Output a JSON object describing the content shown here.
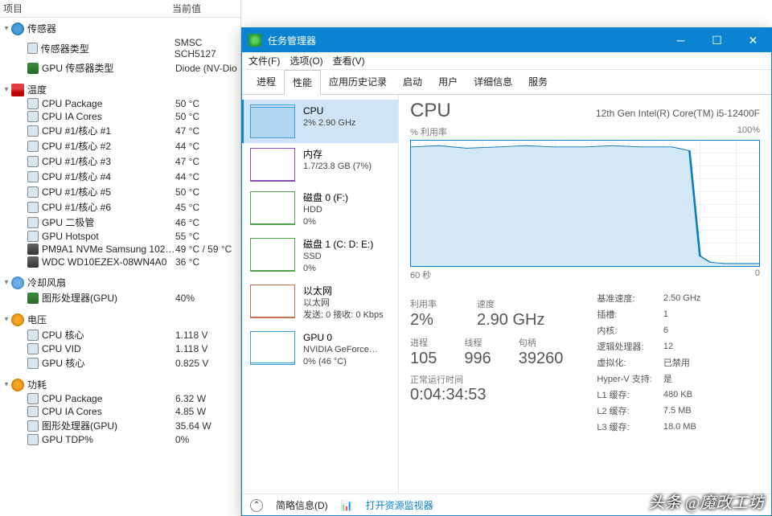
{
  "left": {
    "hdr_item": "项目",
    "hdr_val": "当前值",
    "sensors_label": "传感器",
    "sensor_type": {
      "label": "传感器类型",
      "val": "SMSC SCH5127"
    },
    "gpu_sensor_type": {
      "label": "GPU 传感器类型",
      "val": "Diode  (NV-Dio"
    },
    "temp_label": "温度",
    "temps": [
      {
        "label": "CPU Package",
        "val": "50 °C"
      },
      {
        "label": "CPU IA Cores",
        "val": "50 °C"
      },
      {
        "label": "CPU #1/核心 #1",
        "val": "47 °C"
      },
      {
        "label": "CPU #1/核心 #2",
        "val": "44 °C"
      },
      {
        "label": "CPU #1/核心 #3",
        "val": "47 °C"
      },
      {
        "label": "CPU #1/核心 #4",
        "val": "44 °C"
      },
      {
        "label": "CPU #1/核心 #5",
        "val": "50 °C"
      },
      {
        "label": "CPU #1/核心 #6",
        "val": "45 °C"
      },
      {
        "label": "GPU 二极管",
        "val": "46 °C"
      },
      {
        "label": "GPU Hotspot",
        "val": "55 °C"
      }
    ],
    "disks": [
      {
        "label": "PM9A1 NVMe Samsung 102…",
        "val": "49 °C / 59 °C"
      },
      {
        "label": "WDC WD10EZEX-08WN4A0",
        "val": "36 °C"
      }
    ],
    "fan_label": "冷却风扇",
    "fans": [
      {
        "label": "图形处理器(GPU)",
        "val": "40%"
      }
    ],
    "volt_label": "电压",
    "volts": [
      {
        "label": "CPU 核心",
        "val": "1.118 V"
      },
      {
        "label": "CPU VID",
        "val": "1.118 V"
      },
      {
        "label": "GPU 核心",
        "val": "0.825 V"
      }
    ],
    "power_label": "功耗",
    "powers": [
      {
        "label": "CPU Package",
        "val": "6.32 W"
      },
      {
        "label": "CPU IA Cores",
        "val": "4.85 W"
      },
      {
        "label": "图形处理器(GPU)",
        "val": "35.64 W"
      },
      {
        "label": "GPU TDP%",
        "val": "0%"
      }
    ]
  },
  "tm": {
    "title": "任务管理器",
    "menus": [
      "文件(F)",
      "选项(O)",
      "查看(V)"
    ],
    "tabs": [
      "进程",
      "性能",
      "应用历史记录",
      "启动",
      "用户",
      "详细信息",
      "服务"
    ],
    "side": [
      {
        "t": "CPU",
        "s": "2% 2.90 GHz",
        "color": "#3e9cd6"
      },
      {
        "t": "内存",
        "s": "1.7/23.8 GB (7%)",
        "color": "#8b4fb3"
      },
      {
        "t": "磁盘 0 (F:)",
        "s": "HDD\n0%",
        "color": "#4fa34f"
      },
      {
        "t": "磁盘 1 (C: D: E:)",
        "s": "SSD\n0%",
        "color": "#4fa34f"
      },
      {
        "t": "以太网",
        "s": "以太网\n发送: 0 接收: 0 Kbps",
        "color": "#c0724a"
      },
      {
        "t": "GPU 0",
        "s": "NVIDIA GeForce…\n0% (46 °C)",
        "color": "#3e9cd6"
      }
    ],
    "main": {
      "big": "CPU",
      "model": "12th Gen Intel(R) Core(TM) i5-12400F",
      "util_lbl": "% 利用率",
      "util_max": "100%",
      "x_left": "60 秒",
      "x_right": "0",
      "stats1": [
        {
          "lbl": "利用率",
          "val": "2%"
        },
        {
          "lbl": "速度",
          "val": "2.90 GHz"
        }
      ],
      "stats2": [
        {
          "lbl": "进程",
          "val": "105"
        },
        {
          "lbl": "线程",
          "val": "996"
        },
        {
          "lbl": "句柄",
          "val": "39260"
        }
      ],
      "uptime_lbl": "正常运行时间",
      "uptime": "0:04:34:53",
      "details": [
        [
          "基准速度:",
          "2.50 GHz"
        ],
        [
          "插槽:",
          "1"
        ],
        [
          "内核:",
          "6"
        ],
        [
          "逻辑处理器:",
          "12"
        ],
        [
          "虚拟化:",
          "已禁用"
        ],
        [
          "Hyper-V 支持:",
          "是"
        ],
        [
          "L1 缓存:",
          "480 KB"
        ],
        [
          "L2 缓存:",
          "7.5 MB"
        ],
        [
          "L3 缓存:",
          "18.0 MB"
        ]
      ]
    },
    "footer": {
      "brief": "简略信息(D)",
      "link": "打开资源监视器"
    }
  },
  "chart_data": {
    "type": "line",
    "title": "% 利用率",
    "xlabel": "60 秒 → 0",
    "ylabel": "%",
    "ylim": [
      0,
      100
    ],
    "x": [
      0,
      5,
      10,
      15,
      20,
      25,
      30,
      35,
      40,
      45,
      48,
      50,
      52,
      54,
      56,
      58,
      60
    ],
    "values": [
      95,
      96,
      94,
      95,
      96,
      95,
      95,
      96,
      95,
      95,
      92,
      8,
      3,
      2,
      2,
      3,
      2
    ]
  },
  "watermark": "头条 @魔改工坊"
}
